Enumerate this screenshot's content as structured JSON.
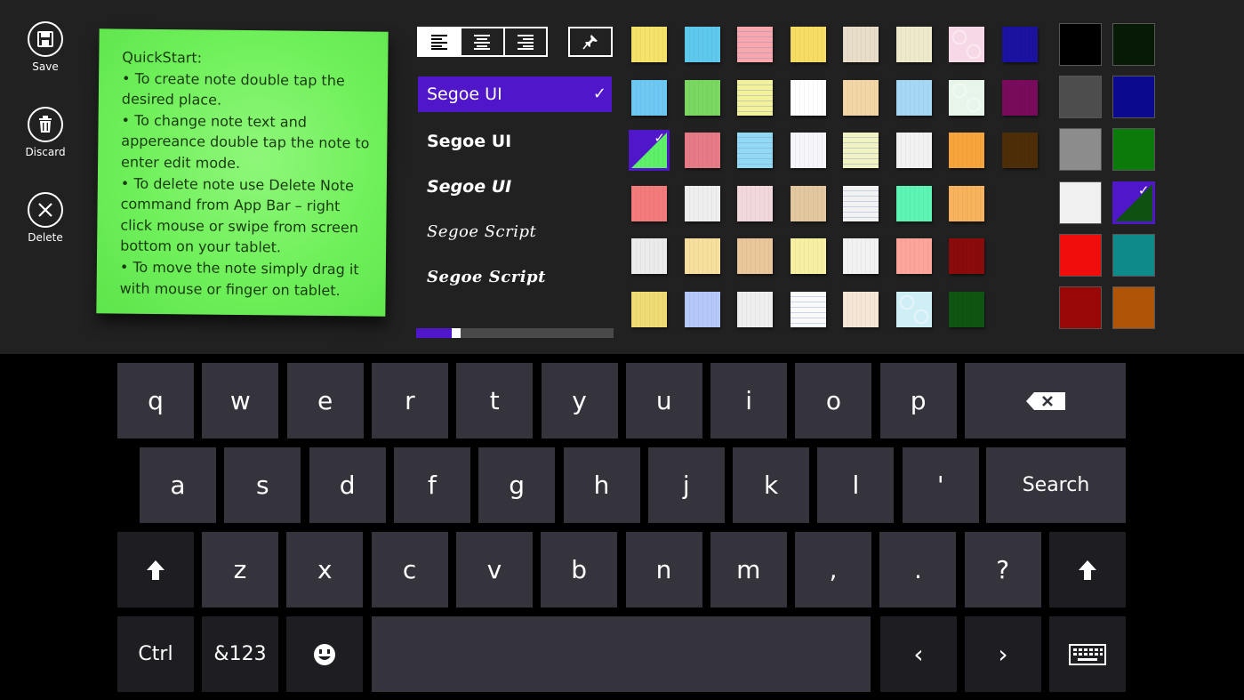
{
  "appbar": {
    "save_label": "Save",
    "discard_label": "Discard",
    "delete_label": "Delete"
  },
  "note": {
    "lines": [
      "QuickStart:",
      " • To create note double tap the",
      "desired place.",
      " • To change note text and",
      "appereance double tap the note to",
      "enter edit mode.",
      " • To delete note use Delete Note",
      "command from App Bar – right",
      "click mouse or swipe from screen",
      "bottom on your tablet.",
      " • To move the note simply drag it",
      "with mouse or finger on tablet."
    ]
  },
  "fonts": {
    "items": [
      "Segoe UI",
      "Segoe UI",
      "Segoe UI",
      "Segoe Script",
      "Segoe Script"
    ],
    "selected_check": "✓"
  },
  "text_size": {
    "value_fraction": 0.18
  },
  "swatches": {
    "colors": [
      [
        "#f4e26a",
        "#5ec9ec",
        "#f9a7ac",
        "#f7dc63",
        "#e8ddc8",
        "#efe9cc",
        "#f7d8e6",
        "#1b12a0"
      ],
      [
        "#6dc9f3",
        "#7ad862",
        "#f3f19a",
        "#ffffff",
        "#f2d6a6",
        "#a6d8f5",
        "#e7f5ea",
        "#7a0a5c"
      ],
      [
        "#5ff06a",
        "#e67b85",
        "#92daf4",
        "#f5f5fa",
        "#f1f3c3",
        "#f2f2f2",
        "#f7a53a",
        "#4e2e09"
      ],
      [
        "#f47b7b",
        "#eeeeee",
        "#f2d8dc",
        "#e3c79e",
        "#f2f2f2",
        "#5ef5b4",
        "#f7b45c",
        "#212121"
      ],
      [
        "#ebebeb",
        "#f7df9d",
        "#eac69a",
        "#f7f0a2",
        "#f2f2f2",
        "#fca59a",
        "#8b0a0a",
        "#212121"
      ],
      [
        "#eedb74",
        "#b4c8fa",
        "#eeeeee",
        "#fafafa",
        "#f5e6d6",
        "#cfeef5",
        "#0f5511",
        "#212121"
      ]
    ],
    "selected_index": [
      2,
      0
    ]
  },
  "colors": {
    "grid": [
      [
        "#000000",
        "#071a06"
      ],
      [
        "#4d4d4d",
        "#0b0a8f"
      ],
      [
        "#8c8c8c",
        "#0b7a0b"
      ],
      [
        "#f0f0f0",
        "#0e5110"
      ],
      [
        "#f20d0d",
        "#0e8a8a"
      ],
      [
        "#9a0707",
        "#b05408"
      ]
    ],
    "selected_index": [
      3,
      1
    ]
  },
  "keyboard": {
    "row1": [
      "q",
      "w",
      "e",
      "r",
      "t",
      "y",
      "u",
      "i",
      "o",
      "p"
    ],
    "row2": [
      "a",
      "s",
      "d",
      "f",
      "g",
      "h",
      "j",
      "k",
      "l",
      "'"
    ],
    "row3": [
      "z",
      "x",
      "c",
      "v",
      "b",
      "n",
      "m",
      ",",
      ".",
      "?"
    ],
    "search_label": "Search",
    "ctrl_label": "Ctrl",
    "numbers_label": "&123",
    "shift_glyph": "🡑",
    "left_glyph": "‹",
    "right_glyph": "›"
  }
}
